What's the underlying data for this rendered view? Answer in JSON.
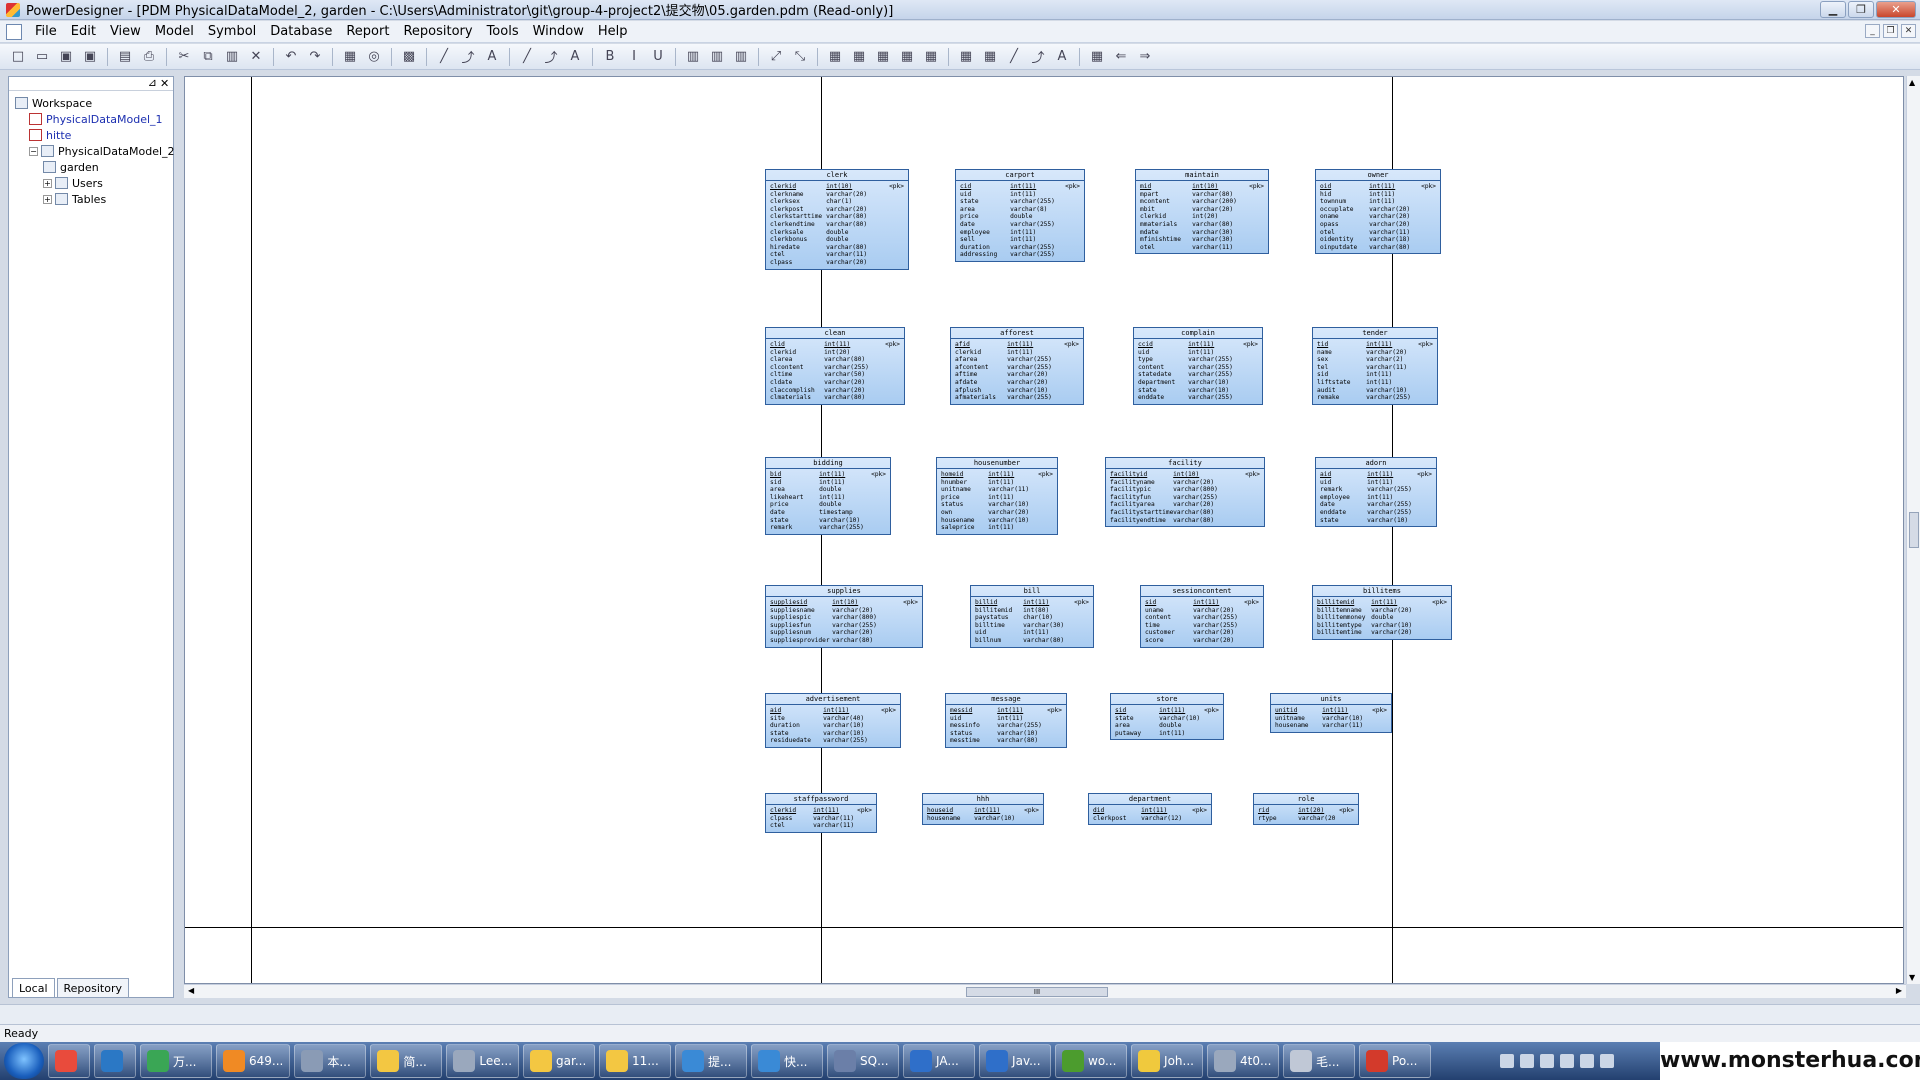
{
  "window": {
    "title": "PowerDesigner - [PDM PhysicalDataModel_2, garden - C:\\Users\\Administrator\\git\\group-4-project2\\提交物\\05.garden.pdm (Read-only)]",
    "minimize": "▁",
    "restore": "❐",
    "close": "✕"
  },
  "menu": [
    "File",
    "Edit",
    "View",
    "Model",
    "Symbol",
    "Database",
    "Report",
    "Repository",
    "Tools",
    "Window",
    "Help"
  ],
  "mdi": {
    "min": "_",
    "restore": "❐",
    "close": "✕"
  },
  "toolbar": [
    "□",
    "▭",
    "▣",
    "▣",
    "|",
    "▤",
    "⎙",
    "|",
    "✂",
    "⧉",
    "▥",
    "✕",
    "|",
    "↶",
    "↷",
    "|",
    "▦",
    "◎",
    "|",
    "▩",
    "|",
    "╱",
    "⤴",
    "A",
    "|",
    "╱",
    "⤴",
    "A",
    "|",
    "B",
    "I",
    "U",
    "|",
    "▥",
    "▥",
    "▥",
    "|",
    "⤢",
    "⤡",
    "|",
    "▦",
    "▦",
    "▦",
    "▦",
    "▦",
    "|",
    "▦",
    "▦",
    "╱",
    "⤴",
    "A",
    "|",
    "▦",
    "⇐",
    "⇒"
  ],
  "browser": {
    "close": "✕",
    "pin": "⊿",
    "tree": [
      {
        "label": "Workspace",
        "level": 0,
        "blue": false,
        "exp": ""
      },
      {
        "label": "PhysicalDataModel_1",
        "level": 1,
        "blue": true,
        "exp": ""
      },
      {
        "label": "hitte",
        "level": 1,
        "blue": true,
        "exp": ""
      },
      {
        "label": "PhysicalDataModel_2",
        "level": 1,
        "blue": false,
        "exp": "−"
      },
      {
        "label": "garden",
        "level": 2,
        "blue": false,
        "exp": ""
      },
      {
        "label": "Users",
        "level": 2,
        "blue": false,
        "exp": "+"
      },
      {
        "label": "Tables",
        "level": 2,
        "blue": false,
        "exp": "+"
      }
    ],
    "tabs": [
      "Local",
      "Repository"
    ]
  },
  "tables": [
    {
      "name": "clerk",
      "cols": [
        [
          "clerkid",
          "int(10)",
          "<pk>"
        ],
        [
          "clerkname",
          "varchar(20)",
          ""
        ],
        [
          "clerksex",
          "char(1)",
          ""
        ],
        [
          "clerkpost",
          "varchar(20)",
          ""
        ],
        [
          "clerkstarttime",
          "varchar(80)",
          ""
        ],
        [
          "clerkendtime",
          "varchar(80)",
          ""
        ],
        [
          "clerksale",
          "double",
          ""
        ],
        [
          "clerkbonus",
          "double",
          ""
        ],
        [
          "hiredate",
          "varchar(80)",
          ""
        ],
        [
          "ctel",
          "varchar(11)",
          ""
        ],
        [
          "clpass",
          "varchar(20)",
          ""
        ]
      ]
    },
    {
      "name": "carport",
      "cols": [
        [
          "cid",
          "int(11)",
          "<pk>"
        ],
        [
          "uid",
          "int(11)",
          ""
        ],
        [
          "state",
          "varchar(255)",
          ""
        ],
        [
          "area",
          "varchar(8)",
          ""
        ],
        [
          "price",
          "double",
          ""
        ],
        [
          "date",
          "varchar(255)",
          ""
        ],
        [
          "employee",
          "int(11)",
          ""
        ],
        [
          "sell",
          "int(11)",
          ""
        ],
        [
          "duration",
          "varchar(255)",
          ""
        ],
        [
          "addressing",
          "varchar(255)",
          ""
        ]
      ]
    },
    {
      "name": "maintain",
      "cols": [
        [
          "mid",
          "int(10)",
          "<pk>"
        ],
        [
          "mpart",
          "varchar(80)",
          ""
        ],
        [
          "mcontent",
          "varchar(200)",
          ""
        ],
        [
          "mbit",
          "varchar(20)",
          ""
        ],
        [
          "clerkid",
          "int(20)",
          ""
        ],
        [
          "mmaterials",
          "varchar(80)",
          ""
        ],
        [
          "mdate",
          "varchar(30)",
          ""
        ],
        [
          "mfinishtime",
          "varchar(30)",
          ""
        ],
        [
          "otel",
          "varchar(11)",
          ""
        ]
      ]
    },
    {
      "name": "owner",
      "cols": [
        [
          "oid",
          "int(11)",
          "<pk>"
        ],
        [
          "hid",
          "int(11)",
          ""
        ],
        [
          "townnum",
          "int(11)",
          ""
        ],
        [
          "occuplate",
          "varchar(20)",
          ""
        ],
        [
          "oname",
          "varchar(20)",
          ""
        ],
        [
          "opass",
          "varchar(20)",
          ""
        ],
        [
          "otel",
          "varchar(11)",
          ""
        ],
        [
          "oidentity",
          "varchar(18)",
          ""
        ],
        [
          "oinputdate",
          "varchar(80)",
          ""
        ]
      ]
    },
    {
      "name": "clean",
      "cols": [
        [
          "clid",
          "int(11)",
          "<pk>"
        ],
        [
          "clerkid",
          "int(20)",
          ""
        ],
        [
          "clarea",
          "varchar(80)",
          ""
        ],
        [
          "clcontent",
          "varchar(255)",
          ""
        ],
        [
          "cltime",
          "varchar(50)",
          ""
        ],
        [
          "cldate",
          "varchar(20)",
          ""
        ],
        [
          "claccomplish",
          "varchar(20)",
          ""
        ],
        [
          "clmaterials",
          "varchar(80)",
          ""
        ]
      ]
    },
    {
      "name": "afforest",
      "cols": [
        [
          "afid",
          "int(11)",
          "<pk>"
        ],
        [
          "clerkid",
          "int(11)",
          ""
        ],
        [
          "afarea",
          "varchar(255)",
          ""
        ],
        [
          "afcontent",
          "varchar(255)",
          ""
        ],
        [
          "aftime",
          "varchar(20)",
          ""
        ],
        [
          "afdate",
          "varchar(20)",
          ""
        ],
        [
          "afplush",
          "varchar(10)",
          ""
        ],
        [
          "afmaterials",
          "varchar(255)",
          ""
        ]
      ]
    },
    {
      "name": "complain",
      "cols": [
        [
          "ccid",
          "int(11)",
          "<pk>"
        ],
        [
          "uid",
          "int(11)",
          ""
        ],
        [
          "type",
          "varchar(255)",
          ""
        ],
        [
          "content",
          "varchar(255)",
          ""
        ],
        [
          "statedate",
          "varchar(255)",
          ""
        ],
        [
          "department",
          "varchar(10)",
          ""
        ],
        [
          "state",
          "varchar(10)",
          ""
        ],
        [
          "enddate",
          "varchar(255)",
          ""
        ]
      ]
    },
    {
      "name": "tender",
      "cols": [
        [
          "tid",
          "int(11)",
          "<pk>"
        ],
        [
          "name",
          "varchar(20)",
          ""
        ],
        [
          "sex",
          "varchar(2)",
          ""
        ],
        [
          "tel",
          "varchar(11)",
          ""
        ],
        [
          "sid",
          "int(11)",
          ""
        ],
        [
          "liftstate",
          "int(11)",
          ""
        ],
        [
          "audit",
          "varchar(10)",
          ""
        ],
        [
          "remake",
          "varchar(255)",
          ""
        ]
      ]
    },
    {
      "name": "bidding",
      "cols": [
        [
          "bid",
          "int(11)",
          "<pk>"
        ],
        [
          "sid",
          "int(11)",
          ""
        ],
        [
          "area",
          "double",
          ""
        ],
        [
          "likeheart",
          "int(11)",
          ""
        ],
        [
          "price",
          "double",
          ""
        ],
        [
          "date",
          "timestamp",
          ""
        ],
        [
          "state",
          "varchar(10)",
          ""
        ],
        [
          "remark",
          "varchar(255)",
          ""
        ]
      ]
    },
    {
      "name": "housenumber",
      "cols": [
        [
          "homeid",
          "int(11)",
          "<pk>"
        ],
        [
          "hnumber",
          "int(11)",
          ""
        ],
        [
          "unitname",
          "varchar(11)",
          ""
        ],
        [
          "price",
          "int(11)",
          ""
        ],
        [
          "status",
          "varchar(10)",
          ""
        ],
        [
          "own",
          "varchar(20)",
          ""
        ],
        [
          "housename",
          "varchar(10)",
          ""
        ],
        [
          "saleprice",
          "int(11)",
          ""
        ]
      ]
    },
    {
      "name": "facility",
      "cols": [
        [
          "facilityid",
          "int(10)",
          "<pk>"
        ],
        [
          "facilityname",
          "varchar(20)",
          ""
        ],
        [
          "facilitypic",
          "varchar(800)",
          ""
        ],
        [
          "facilityfun",
          "varchar(255)",
          ""
        ],
        [
          "facilityarea",
          "varchar(20)",
          ""
        ],
        [
          "facilitystarttime",
          "varchar(80)",
          ""
        ],
        [
          "facilityendtime",
          "varchar(80)",
          ""
        ]
      ]
    },
    {
      "name": "adorn",
      "cols": [
        [
          "aid",
          "int(11)",
          "<pk>"
        ],
        [
          "uid",
          "int(11)",
          ""
        ],
        [
          "remark",
          "varchar(255)",
          ""
        ],
        [
          "employee",
          "int(11)",
          ""
        ],
        [
          "date",
          "varchar(255)",
          ""
        ],
        [
          "enddate",
          "varchar(255)",
          ""
        ],
        [
          "state",
          "varchar(10)",
          ""
        ]
      ]
    },
    {
      "name": "supplies",
      "cols": [
        [
          "suppliesid",
          "int(10)",
          "<pk>"
        ],
        [
          "suppliesname",
          "varchar(20)",
          ""
        ],
        [
          "suppliespic",
          "varchar(800)",
          ""
        ],
        [
          "suppliesfun",
          "varchar(255)",
          ""
        ],
        [
          "suppliesnum",
          "varchar(20)",
          ""
        ],
        [
          "suppliesprovider",
          "varchar(80)",
          ""
        ]
      ]
    },
    {
      "name": "bill",
      "cols": [
        [
          "billid",
          "int(11)",
          "<pk>"
        ],
        [
          "billitemid",
          "int(80)",
          ""
        ],
        [
          "paystatus",
          "char(10)",
          ""
        ],
        [
          "billtime",
          "varchar(30)",
          ""
        ],
        [
          "uid",
          "int(11)",
          ""
        ],
        [
          "billnum",
          "varchar(80)",
          ""
        ]
      ]
    },
    {
      "name": "sessioncontent",
      "cols": [
        [
          "sid",
          "int(11)",
          "<pk>"
        ],
        [
          "uname",
          "varchar(20)",
          ""
        ],
        [
          "content",
          "varchar(255)",
          ""
        ],
        [
          "time",
          "varchar(255)",
          ""
        ],
        [
          "customer",
          "varchar(20)",
          ""
        ],
        [
          "score",
          "varchar(20)",
          ""
        ]
      ]
    },
    {
      "name": "billitems",
      "cols": [
        [
          "billitemid",
          "int(11)",
          "<pk>"
        ],
        [
          "billitemname",
          "varchar(20)",
          ""
        ],
        [
          "billitemmoney",
          "double",
          ""
        ],
        [
          "billitemtype",
          "varchar(10)",
          ""
        ],
        [
          "billitemtime",
          "varchar(20)",
          ""
        ]
      ]
    },
    {
      "name": "advertisement",
      "cols": [
        [
          "aid",
          "int(11)",
          "<pk>"
        ],
        [
          "site",
          "varchar(40)",
          ""
        ],
        [
          "duration",
          "varchar(10)",
          ""
        ],
        [
          "state",
          "varchar(10)",
          ""
        ],
        [
          "residuedate",
          "varchar(255)",
          ""
        ]
      ]
    },
    {
      "name": "message",
      "cols": [
        [
          "messid",
          "int(11)",
          "<pk>"
        ],
        [
          "uid",
          "int(11)",
          ""
        ],
        [
          "messinfo",
          "varchar(255)",
          ""
        ],
        [
          "status",
          "varchar(10)",
          ""
        ],
        [
          "messtime",
          "varchar(80)",
          ""
        ]
      ]
    },
    {
      "name": "store",
      "cols": [
        [
          "sid",
          "int(11)",
          "<pk>"
        ],
        [
          "state",
          "varchar(10)",
          ""
        ],
        [
          "area",
          "double",
          ""
        ],
        [
          "putaway",
          "int(11)",
          ""
        ]
      ]
    },
    {
      "name": "units",
      "cols": [
        [
          "unitid",
          "int(11)",
          "<pk>"
        ],
        [
          "unitname",
          "varchar(10)",
          ""
        ],
        [
          "housename",
          "varchar(11)",
          ""
        ]
      ]
    },
    {
      "name": "staffpassword",
      "cols": [
        [
          "clerkid",
          "int(11)",
          "<pk>"
        ],
        [
          "clpass",
          "varchar(11)",
          ""
        ],
        [
          "ctel",
          "varchar(11)",
          ""
        ]
      ]
    },
    {
      "name": "hhh",
      "cols": [
        [
          "houseid",
          "int(11)",
          "<pk>"
        ],
        [
          "housename",
          "varchar(10)",
          ""
        ]
      ]
    },
    {
      "name": "department",
      "cols": [
        [
          "did",
          "int(11)",
          "<pk>"
        ],
        [
          "clerkpost",
          "varchar(12)",
          ""
        ]
      ]
    },
    {
      "name": "role",
      "cols": [
        [
          "rid",
          "int(20)",
          "<pk>"
        ],
        [
          "rtype",
          "varchar(20)",
          ""
        ]
      ]
    }
  ],
  "scroll": {
    "grip": "III",
    "up": "▲",
    "down": "▼",
    "left": "◀",
    "right": "▶"
  },
  "status": "Ready",
  "taskbar": [
    {
      "label": "",
      "color": "#e94b3c"
    },
    {
      "label": "",
      "color": "#2b78c5"
    },
    {
      "label": "万...",
      "color": "#3aa655"
    },
    {
      "label": "649...",
      "color": "#f08a24"
    },
    {
      "label": "本...",
      "color": "#8a9bb5"
    },
    {
      "label": "简...",
      "color": "#f3c742"
    },
    {
      "label": "Lee...",
      "color": "#9aa8bd"
    },
    {
      "label": "gar...",
      "color": "#f3c742"
    },
    {
      "label": "11...",
      "color": "#f3c742"
    },
    {
      "label": "提...",
      "color": "#3a8ad6"
    },
    {
      "label": "快...",
      "color": "#3a8ad6"
    },
    {
      "label": "SQ...",
      "color": "#6b7fa8"
    },
    {
      "label": "JA...",
      "color": "#2f6fc9"
    },
    {
      "label": "Jav...",
      "color": "#2f6fc9"
    },
    {
      "label": "wo...",
      "color": "#4c9c2e"
    },
    {
      "label": "Joh...",
      "color": "#f0c93d"
    },
    {
      "label": "4t0...",
      "color": "#9aa8bd"
    },
    {
      "label": "毛...",
      "color": "#c0c8d6"
    },
    {
      "label": "Po...",
      "color": "#d33a2b"
    }
  ],
  "watermark": "www.monsterhua.com"
}
